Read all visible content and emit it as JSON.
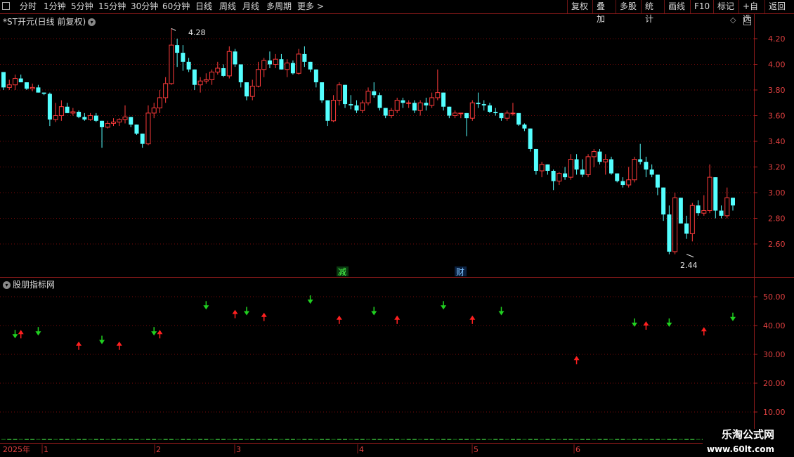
{
  "toolbar": {
    "tabs": [
      "分时",
      "1分钟",
      "5分钟",
      "15分钟",
      "30分钟",
      "60分钟",
      "日线",
      "周线",
      "月线",
      "多周期",
      "更多 >"
    ],
    "right_buttons": [
      "复权",
      "叠加",
      "多股",
      "统计",
      "画线",
      "F10",
      "标记",
      "+自选",
      "返回"
    ]
  },
  "stock": {
    "title": "*ST开元(日线 前复权)"
  },
  "indicator": {
    "title": "股朋指标网"
  },
  "markers": {
    "jian": "减",
    "cai": "财"
  },
  "annotations": {
    "high": "4.28",
    "low": "2.44"
  },
  "axis": {
    "year_label": "2025年",
    "month_labels": [
      "1",
      "2",
      "3",
      "4",
      "5",
      "6"
    ]
  },
  "watermark": {
    "line1": "乐淘公式网",
    "line2": "www.60lt.com"
  },
  "chart_data": [
    {
      "type": "candlestick",
      "title": "*ST开元(日线 前复权)",
      "ylim": [
        2.4,
        4.35
      ],
      "y_ticks": [
        4.2,
        4.0,
        3.8,
        3.6,
        3.4,
        3.2,
        3.0,
        2.8,
        2.6
      ],
      "colors": {
        "up": "#ff3b3b",
        "down": "#54ffff"
      },
      "ohlc": [
        [
          3.94,
          3.94,
          3.8,
          3.82
        ],
        [
          3.82,
          3.88,
          3.8,
          3.84
        ],
        [
          3.84,
          3.92,
          3.8,
          3.89
        ],
        [
          3.89,
          3.92,
          3.86,
          3.86
        ],
        [
          3.86,
          3.86,
          3.8,
          3.81
        ],
        [
          3.81,
          3.85,
          3.79,
          3.82
        ],
        [
          3.82,
          3.84,
          3.78,
          3.78
        ],
        [
          3.78,
          3.78,
          3.76,
          3.77
        ],
        [
          3.77,
          3.78,
          3.52,
          3.57
        ],
        [
          3.57,
          3.7,
          3.55,
          3.6
        ],
        [
          3.6,
          3.72,
          3.56,
          3.67
        ],
        [
          3.67,
          3.7,
          3.62,
          3.62
        ],
        [
          3.62,
          3.66,
          3.6,
          3.63
        ],
        [
          3.63,
          3.64,
          3.58,
          3.59
        ],
        [
          3.59,
          3.62,
          3.56,
          3.57
        ],
        [
          3.57,
          3.62,
          3.56,
          3.6
        ],
        [
          3.6,
          3.62,
          3.55,
          3.56
        ],
        [
          3.56,
          3.56,
          3.35,
          3.51
        ],
        [
          3.51,
          3.56,
          3.5,
          3.54
        ],
        [
          3.54,
          3.58,
          3.52,
          3.55
        ],
        [
          3.55,
          3.58,
          3.52,
          3.57
        ],
        [
          3.57,
          3.68,
          3.54,
          3.59
        ],
        [
          3.59,
          3.59,
          3.51,
          3.53
        ],
        [
          3.53,
          3.53,
          3.45,
          3.46
        ],
        [
          3.46,
          3.46,
          3.35,
          3.38
        ],
        [
          3.38,
          3.68,
          3.37,
          3.62
        ],
        [
          3.62,
          3.7,
          3.58,
          3.66
        ],
        [
          3.66,
          3.8,
          3.62,
          3.74
        ],
        [
          3.74,
          3.9,
          3.7,
          3.85
        ],
        [
          3.85,
          4.28,
          3.84,
          4.15
        ],
        [
          4.15,
          4.2,
          3.98,
          4.09
        ],
        [
          4.09,
          4.15,
          3.95,
          4.02
        ],
        [
          4.02,
          4.05,
          3.94,
          3.96
        ],
        [
          3.96,
          3.96,
          3.8,
          3.84
        ],
        [
          3.84,
          3.9,
          3.78,
          3.87
        ],
        [
          3.87,
          3.93,
          3.85,
          3.88
        ],
        [
          3.88,
          3.96,
          3.84,
          3.94
        ],
        [
          3.94,
          4.02,
          3.92,
          3.97
        ],
        [
          3.97,
          4.0,
          3.9,
          3.91
        ],
        [
          3.91,
          4.14,
          3.89,
          4.1
        ],
        [
          4.1,
          4.12,
          3.98,
          4.0
        ],
        [
          4.0,
          4.0,
          3.82,
          3.86
        ],
        [
          3.86,
          3.86,
          3.72,
          3.75
        ],
        [
          3.75,
          3.88,
          3.72,
          3.83
        ],
        [
          3.83,
          4.02,
          3.82,
          3.96
        ],
        [
          3.96,
          4.05,
          3.9,
          4.03
        ],
        [
          4.03,
          4.1,
          3.97,
          4.0
        ],
        [
          4.0,
          4.08,
          3.97,
          4.04
        ],
        [
          4.04,
          4.08,
          3.96,
          3.96
        ],
        [
          3.96,
          4.04,
          3.9,
          4.01
        ],
        [
          4.01,
          4.03,
          3.92,
          3.93
        ],
        [
          3.93,
          4.12,
          3.92,
          4.08
        ],
        [
          4.08,
          4.14,
          3.98,
          4.02
        ],
        [
          4.02,
          4.02,
          3.94,
          3.96
        ],
        [
          3.96,
          3.96,
          3.82,
          3.86
        ],
        [
          3.86,
          3.86,
          3.7,
          3.72
        ],
        [
          3.72,
          3.72,
          3.52,
          3.56
        ],
        [
          3.56,
          3.76,
          3.55,
          3.72
        ],
        [
          3.72,
          3.86,
          3.68,
          3.84
        ],
        [
          3.84,
          3.84,
          3.66,
          3.69
        ],
        [
          3.69,
          3.76,
          3.65,
          3.68
        ],
        [
          3.68,
          3.72,
          3.62,
          3.64
        ],
        [
          3.64,
          3.72,
          3.62,
          3.7
        ],
        [
          3.7,
          3.82,
          3.68,
          3.79
        ],
        [
          3.79,
          3.86,
          3.74,
          3.76
        ],
        [
          3.76,
          3.78,
          3.64,
          3.66
        ],
        [
          3.66,
          3.66,
          3.58,
          3.6
        ],
        [
          3.6,
          3.66,
          3.58,
          3.64
        ],
        [
          3.64,
          3.74,
          3.62,
          3.72
        ],
        [
          3.72,
          3.74,
          3.66,
          3.7
        ],
        [
          3.7,
          3.72,
          3.66,
          3.7
        ],
        [
          3.7,
          3.72,
          3.62,
          3.64
        ],
        [
          3.64,
          3.72,
          3.6,
          3.7
        ],
        [
          3.7,
          3.74,
          3.64,
          3.68
        ],
        [
          3.68,
          3.78,
          3.66,
          3.74
        ],
        [
          3.74,
          3.96,
          3.72,
          3.78
        ],
        [
          3.78,
          3.78,
          3.64,
          3.67
        ],
        [
          3.67,
          3.67,
          3.58,
          3.6
        ],
        [
          3.6,
          3.64,
          3.58,
          3.62
        ],
        [
          3.62,
          3.62,
          3.58,
          3.62
        ],
        [
          3.62,
          3.62,
          3.44,
          3.58
        ],
        [
          3.58,
          3.72,
          3.56,
          3.7
        ],
        [
          3.7,
          3.78,
          3.66,
          3.69
        ],
        [
          3.69,
          3.72,
          3.64,
          3.68
        ],
        [
          3.68,
          3.7,
          3.62,
          3.63
        ],
        [
          3.63,
          3.66,
          3.6,
          3.62
        ],
        [
          3.62,
          3.62,
          3.56,
          3.58
        ],
        [
          3.58,
          3.64,
          3.56,
          3.62
        ],
        [
          3.62,
          3.7,
          3.6,
          3.62
        ],
        [
          3.62,
          3.62,
          3.52,
          3.53
        ],
        [
          3.53,
          3.54,
          3.48,
          3.5
        ],
        [
          3.5,
          3.5,
          3.32,
          3.34
        ],
        [
          3.34,
          3.34,
          3.14,
          3.17
        ],
        [
          3.17,
          3.24,
          3.12,
          3.22
        ],
        [
          3.22,
          3.22,
          3.14,
          3.17
        ],
        [
          3.17,
          3.18,
          3.02,
          3.09
        ],
        [
          3.09,
          3.16,
          3.06,
          3.15
        ],
        [
          3.15,
          3.2,
          3.1,
          3.12
        ],
        [
          3.12,
          3.3,
          3.1,
          3.26
        ],
        [
          3.26,
          3.3,
          3.14,
          3.18
        ],
        [
          3.18,
          3.26,
          3.12,
          3.14
        ],
        [
          3.14,
          3.3,
          3.12,
          3.28
        ],
        [
          3.28,
          3.34,
          3.2,
          3.32
        ],
        [
          3.32,
          3.34,
          3.22,
          3.24
        ],
        [
          3.24,
          3.3,
          3.14,
          3.26
        ],
        [
          3.26,
          3.28,
          3.14,
          3.15
        ],
        [
          3.15,
          3.15,
          3.08,
          3.09
        ],
        [
          3.09,
          3.12,
          3.04,
          3.06
        ],
        [
          3.06,
          3.2,
          3.04,
          3.1
        ],
        [
          3.1,
          3.28,
          3.08,
          3.26
        ],
        [
          3.26,
          3.38,
          3.22,
          3.24
        ],
        [
          3.24,
          3.28,
          3.12,
          3.18
        ],
        [
          3.18,
          3.22,
          3.12,
          3.14
        ],
        [
          3.14,
          3.14,
          2.98,
          3.04
        ],
        [
          3.04,
          3.04,
          2.78,
          2.83
        ],
        [
          2.83,
          2.9,
          2.52,
          2.54
        ],
        [
          2.54,
          3.0,
          2.52,
          2.96
        ],
        [
          2.96,
          2.96,
          2.76,
          2.76
        ],
        [
          2.76,
          2.82,
          2.64,
          2.68
        ],
        [
          2.68,
          2.92,
          2.62,
          2.9
        ],
        [
          2.9,
          2.94,
          2.82,
          2.84
        ],
        [
          2.84,
          2.98,
          2.82,
          2.86
        ],
        [
          2.86,
          3.22,
          2.84,
          3.12
        ],
        [
          3.12,
          3.12,
          2.8,
          2.86
        ],
        [
          2.86,
          2.9,
          2.8,
          2.82
        ],
        [
          2.82,
          3.04,
          2.8,
          2.96
        ],
        [
          2.96,
          2.96,
          2.86,
          2.9
        ]
      ]
    },
    {
      "type": "scatter",
      "title": "股朋指标网",
      "ylim": [
        5,
        56
      ],
      "y_ticks": [
        50.0,
        40.0,
        30.0,
        20.0,
        10.0
      ],
      "series": [
        {
          "marker": "arrow-up",
          "color": "#ff2020",
          "x": [
            3,
            13,
            20,
            27,
            40,
            45,
            58,
            68,
            81,
            99,
            111,
            121
          ],
          "y": [
            37,
            33,
            33,
            37,
            44,
            43,
            42,
            42,
            42,
            28,
            40,
            38
          ]
        },
        {
          "marker": "arrow-down",
          "color": "#20d020",
          "x": [
            2,
            6,
            17,
            26,
            35,
            42,
            53,
            64,
            76,
            86,
            109,
            115,
            126
          ],
          "y": [
            37,
            38,
            35,
            38,
            47,
            45,
            49,
            45,
            47,
            45,
            41,
            41,
            43
          ]
        }
      ]
    }
  ]
}
